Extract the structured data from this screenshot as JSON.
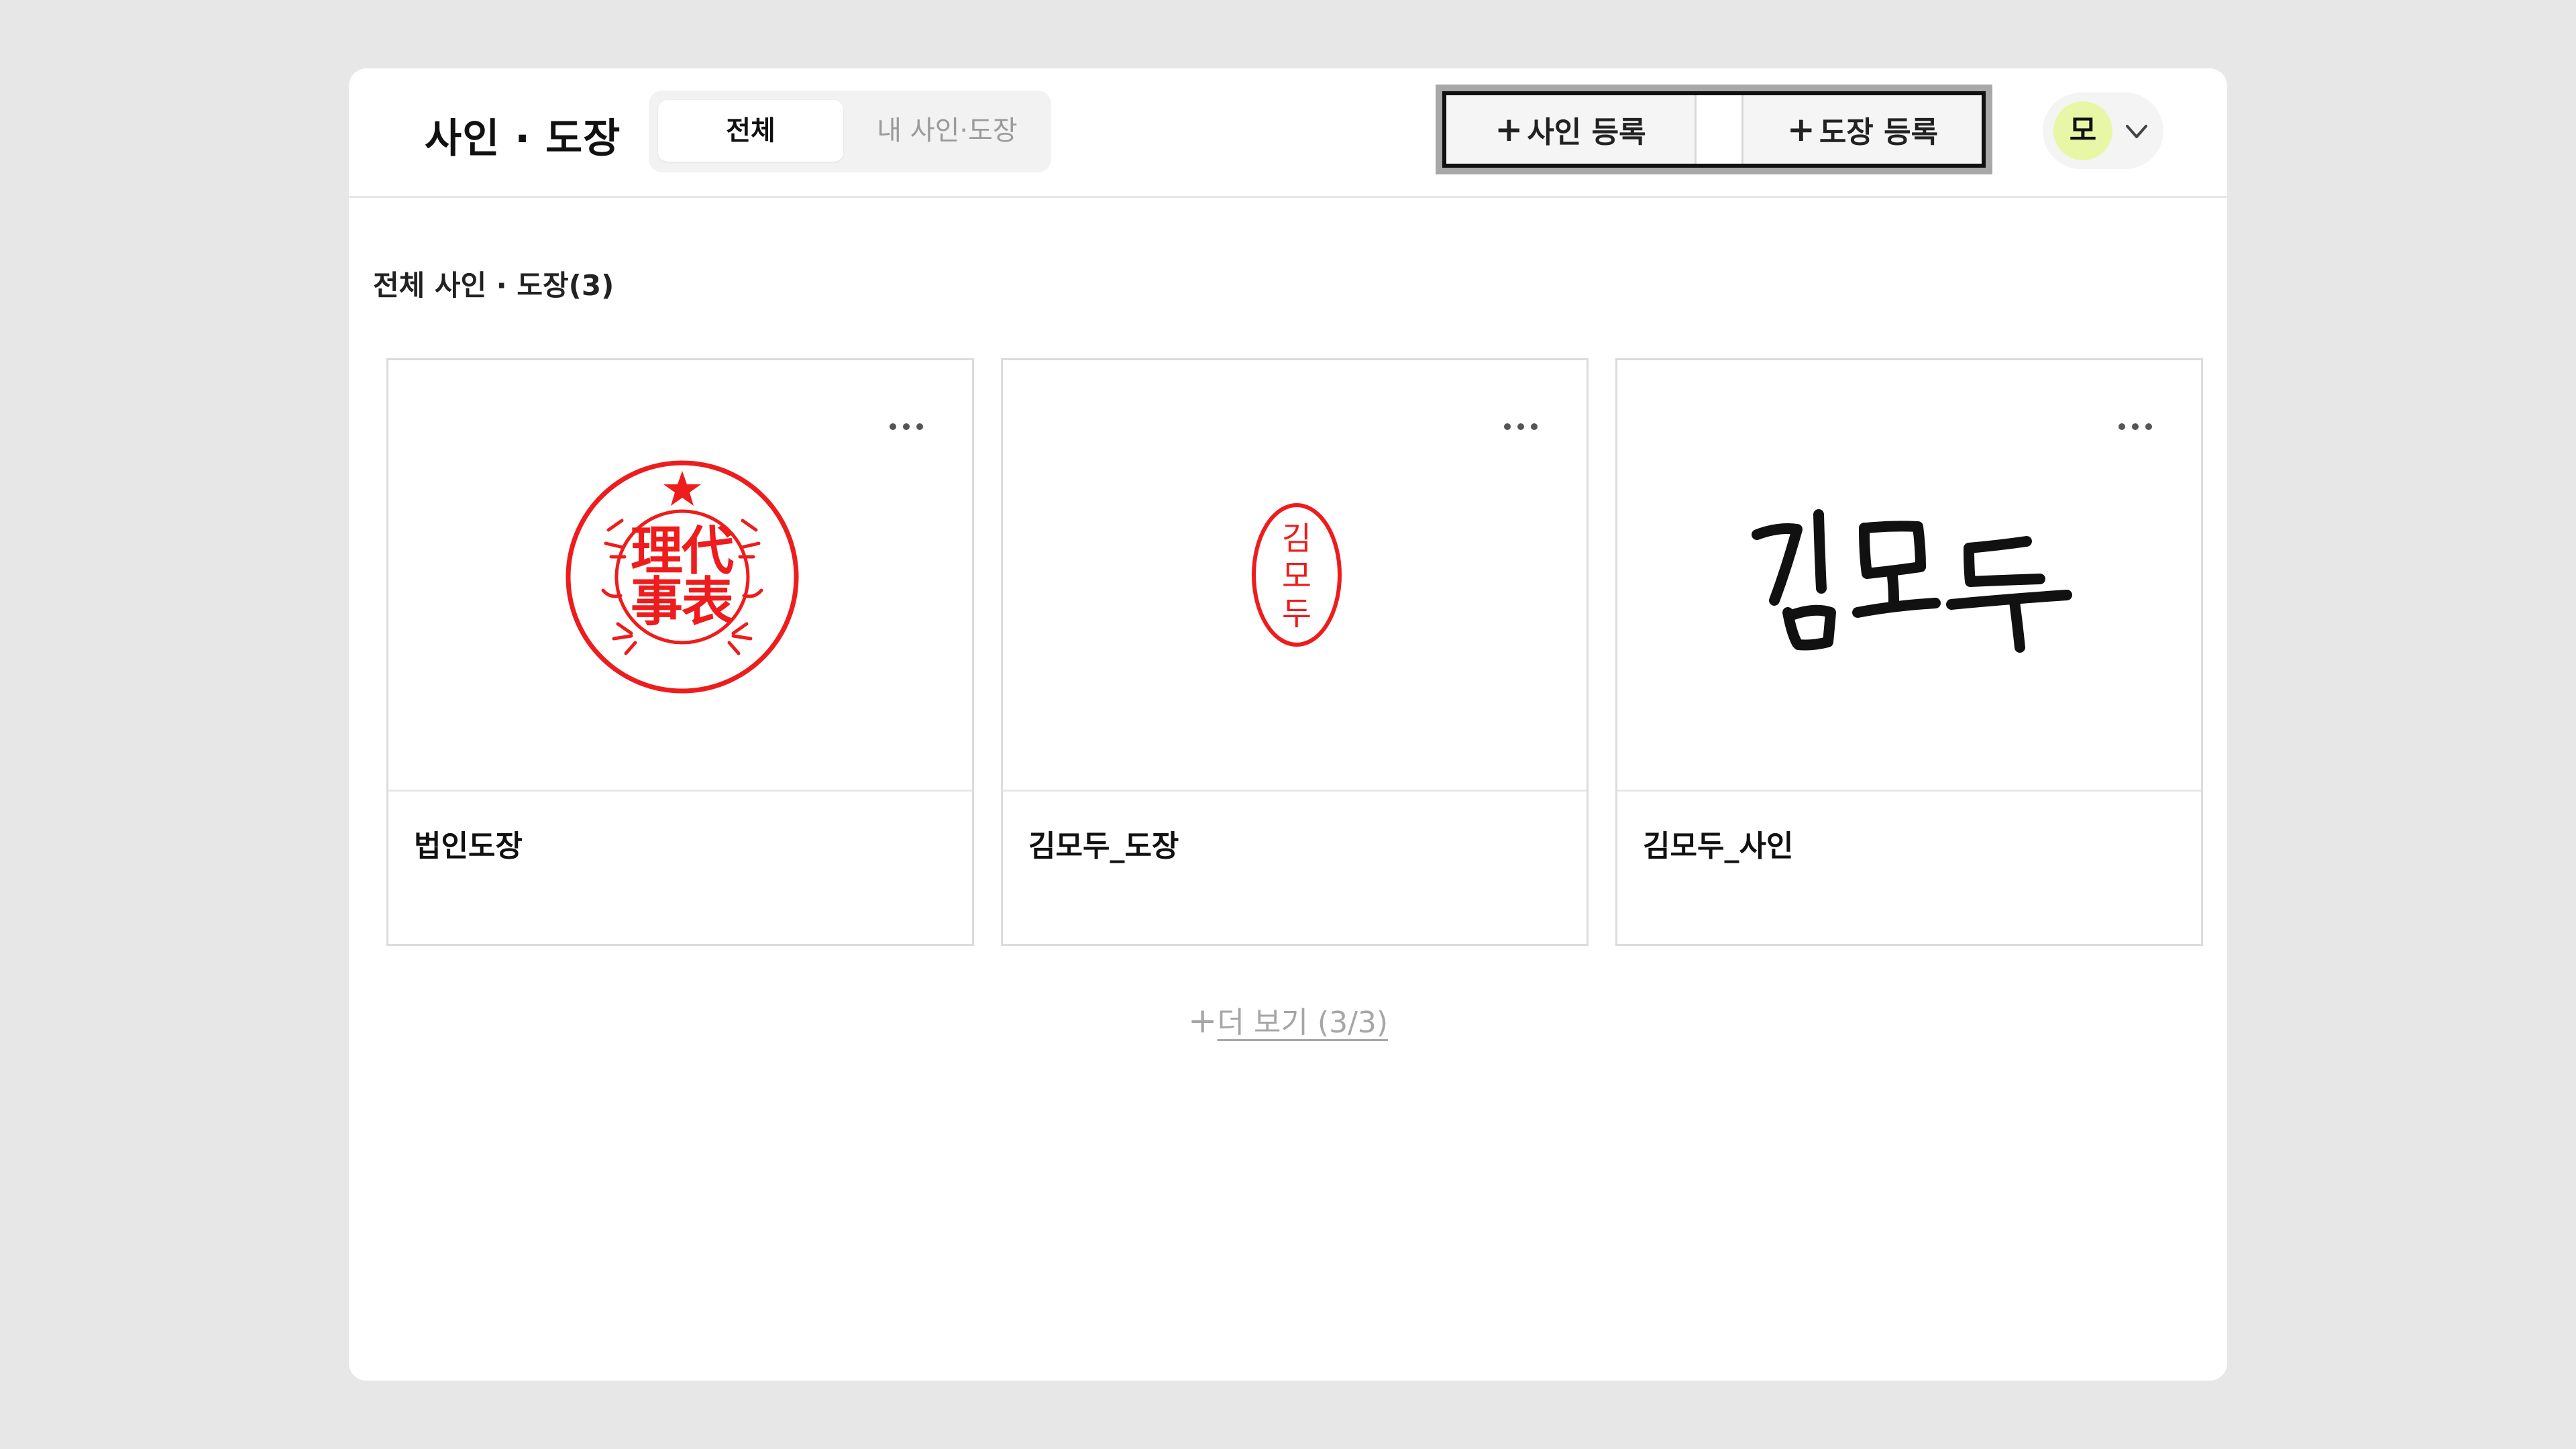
{
  "header": {
    "title": "사인 · 도장",
    "tabs": [
      {
        "label": "전체",
        "active": true
      },
      {
        "label": "내 사인·도장",
        "active": false
      }
    ],
    "register_sign_label": "사인 등록",
    "register_stamp_label": "도장 등록",
    "user_initial": "모"
  },
  "section": {
    "title": "전체 사인 · 도장(3)"
  },
  "cards": [
    {
      "name": "법인도장",
      "image": "corporate-seal-icon",
      "seal_text": [
        "代",
        "表",
        "理",
        "事"
      ]
    },
    {
      "name": "김모두_도장",
      "image": "personal-seal-icon",
      "seal_text": [
        "김",
        "모",
        "두"
      ]
    },
    {
      "name": "김모두_사인",
      "image": "signature-icon",
      "signature_text": "김모두"
    }
  ],
  "load_more": {
    "label": "더 보기 (3/3)"
  },
  "colors": {
    "seal_red": "#ee1c1c",
    "avatar_bg": "#e8f7a6",
    "background": "#e7e7e7"
  }
}
